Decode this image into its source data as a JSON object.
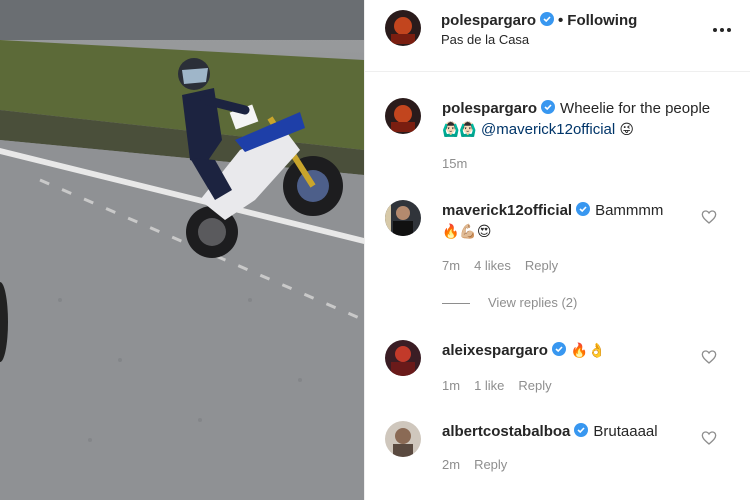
{
  "post": {
    "username": "polespargaro",
    "follow_status": "Following",
    "dot": "•",
    "location": "Pas de la Casa"
  },
  "caption": {
    "username": "polespargaro",
    "text": "Wheelie for the people",
    "emoji_pre": "🙆🏻‍♂️🙆🏻‍♂️",
    "mention": "@maverick12official",
    "emoji_post": "😜",
    "time": "15m"
  },
  "comments": [
    {
      "username": "maverick12official",
      "text": "Bammmm",
      "emoji": "🔥💪🏼😍",
      "time": "7m",
      "likes": "4 likes",
      "reply": "Reply"
    },
    {
      "username": "aleixespargaro",
      "text": "",
      "emoji": "🔥👌",
      "time": "1m",
      "likes": "1 like",
      "reply": "Reply"
    },
    {
      "username": "albertcostabalboa",
      "text": "Brutaaaal",
      "emoji": "",
      "time": "2m",
      "likes": "",
      "reply": "Reply"
    }
  ],
  "view_replies": "View replies (2)",
  "icons": {
    "more": "more-options-icon",
    "verified": "verified-badge-icon",
    "heart": "heart-icon"
  },
  "colors": {
    "verified": "#3897f0",
    "muted": "#8e8e8e",
    "mention": "#003569"
  }
}
